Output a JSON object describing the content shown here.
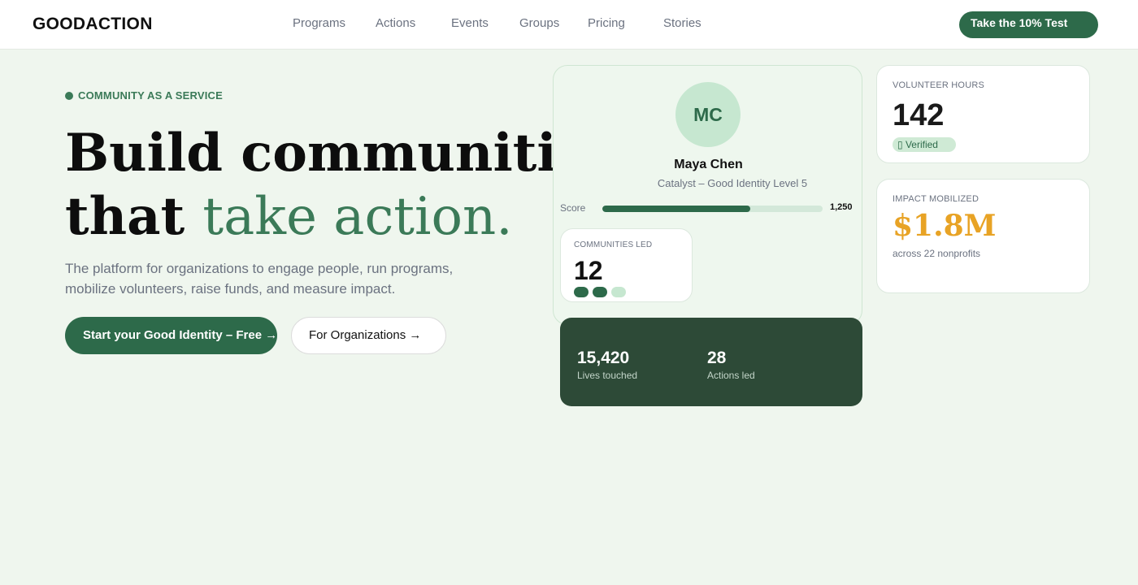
{
  "nav": {
    "logo": "GOODACTION",
    "links": [
      "Programs",
      "Actions",
      "Events",
      "Groups",
      "Pricing",
      "Stories"
    ],
    "cta": "Take the 10% Test"
  },
  "hero": {
    "eyebrow": "COMMUNITY AS A SERVICE",
    "headline_line1": "Build communities",
    "headline_line2_plain": "that ",
    "headline_line2_accent": "take action.",
    "subtext": "The platform for organizations to engage people, run programs, mobilize volunteers, raise funds, and measure impact.",
    "primary_button": "Start your Good Identity – Free →",
    "secondary_button": "For Organizations →"
  },
  "profile": {
    "initials": "MC",
    "name": "Maya Chen",
    "subtitle": "Catalyst – Good Identity Level 5",
    "score_label": "Score",
    "score_value": "1,250",
    "score_fraction": 0.67,
    "communities_label": "COMMUNITIES LED",
    "communities_value": "12"
  },
  "stats": {
    "lives_value": "15,420",
    "lives_label": "Lives touched",
    "actions_value": "28",
    "actions_label": "Actions led"
  },
  "volunteer": {
    "label": "VOLUNTEER HOURS",
    "value": "142",
    "badge_icon": "check-icon",
    "badge": "Verified"
  },
  "impact": {
    "label": "IMPACT MOBILIZED",
    "value": "$1.8M",
    "sub": "across 22 nonprofits"
  },
  "colors": {
    "brand": "#2d6a4a",
    "accent_text": "#3b7a58",
    "gold": "#e8a325",
    "dark_card": "#2d4a37",
    "page_bg": "#eff6ee"
  }
}
